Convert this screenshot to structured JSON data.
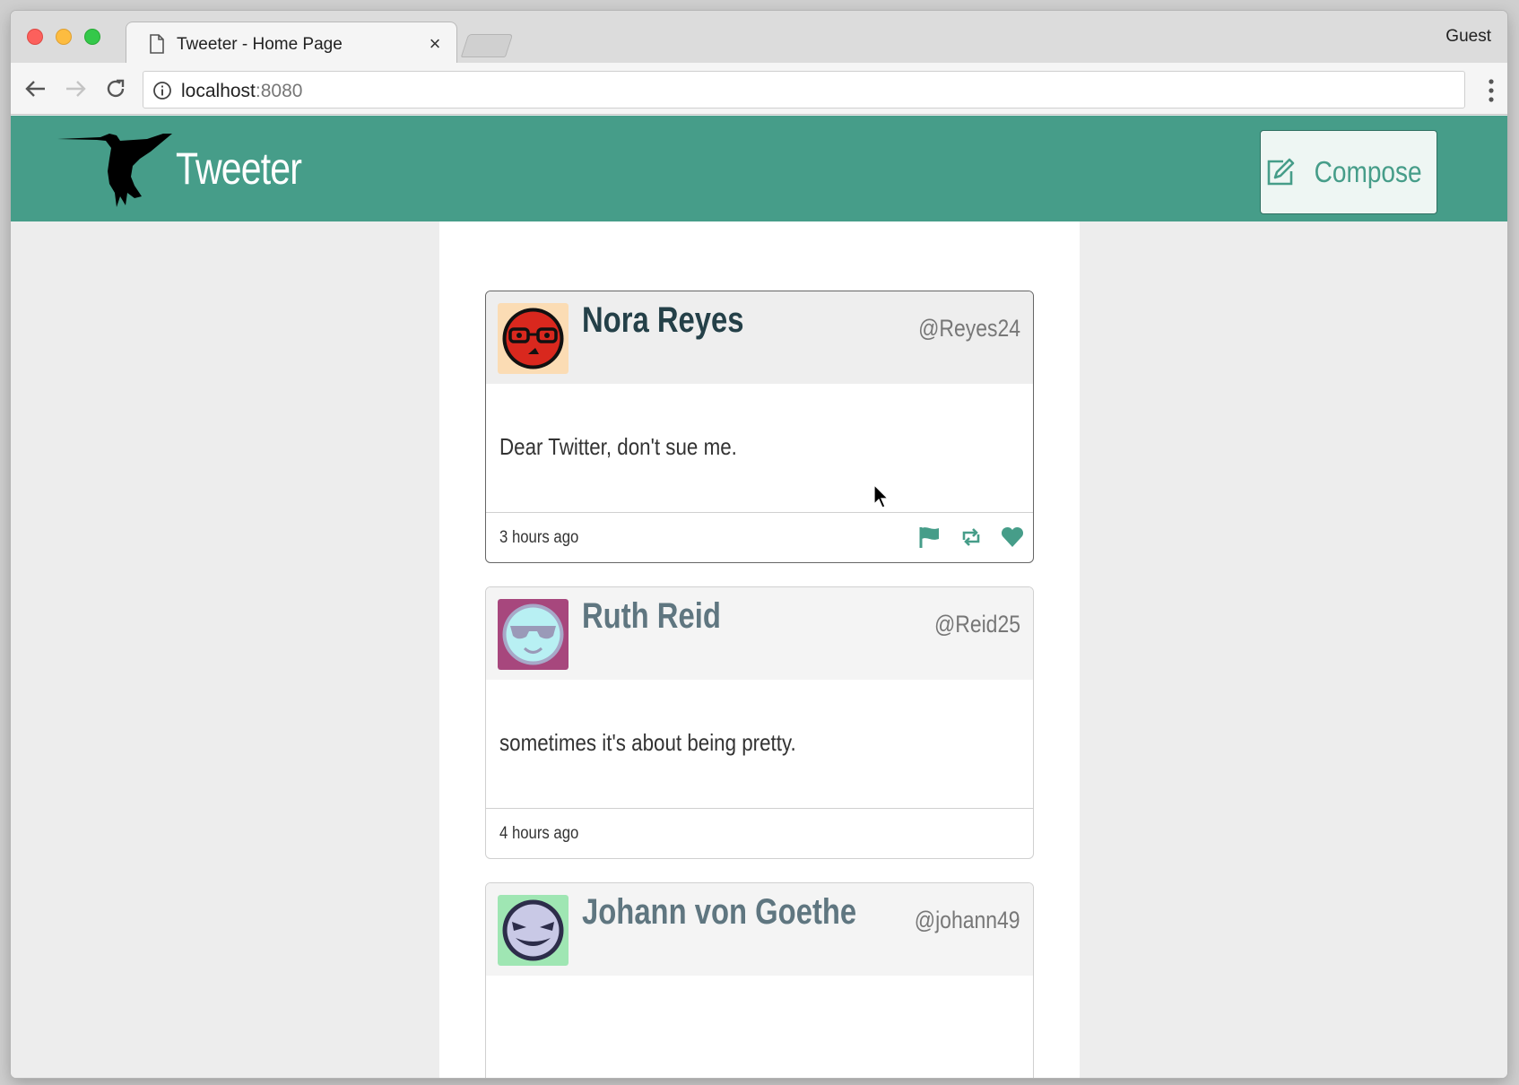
{
  "browser": {
    "tab_title": "Tweeter - Home Page",
    "tab_close": "×",
    "profile": "Guest",
    "url_host": "localhost",
    "url_port": ":8080"
  },
  "app": {
    "brand": "Tweeter",
    "compose_label": "Compose",
    "accent_color": "#469d89"
  },
  "tweets": [
    {
      "name": "Nora Reyes",
      "handle": "@Reyes24",
      "text": "Dear Twitter, don't sue me.",
      "time": "3 hours ago",
      "avatar_bg": "#fbdcb4",
      "avatar_icon": "red-face-glasses-avatar",
      "actions": [
        "flag-icon",
        "retweet-icon",
        "heart-icon"
      ]
    },
    {
      "name": "Ruth Reid",
      "handle": "@Reid25",
      "text": "sometimes it's about being pretty.",
      "time": "4 hours ago",
      "avatar_bg": "#a7477d",
      "avatar_icon": "sunglasses-face-avatar"
    },
    {
      "name": "Johann von Goethe",
      "handle": "@johann49",
      "avatar_bg": "#9fe6b3",
      "avatar_icon": "mischievous-face-avatar"
    }
  ]
}
